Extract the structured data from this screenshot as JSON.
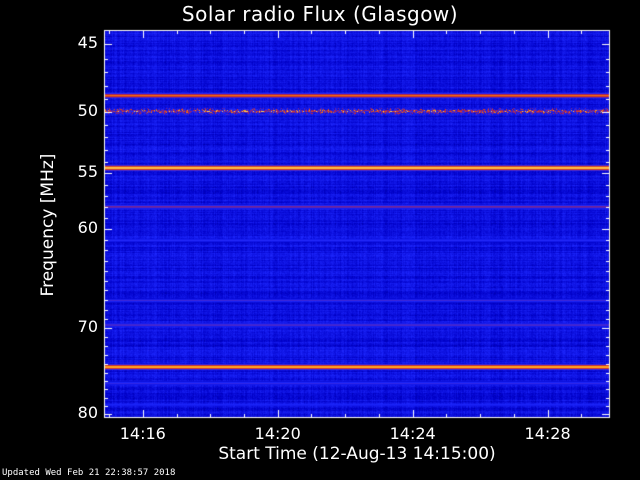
{
  "chart_data": {
    "type": "heatmap",
    "title": "Solar radio Flux (Glasgow)",
    "xlabel": "Start Time (12-Aug-13 14:15:00)",
    "ylabel": "Frequency [MHz]",
    "x_ticks": [
      "14:16",
      "14:20",
      "14:24",
      "14:28"
    ],
    "x_tick_minutes": [
      16,
      20,
      24,
      28
    ],
    "xlim_minutes": [
      14.85,
      29.85
    ],
    "y_ticks": [
      45,
      50,
      55,
      60,
      70,
      80
    ],
    "ylim_mhz": [
      44.0,
      80.5
    ],
    "y_scale": "log",
    "colormap": [
      "#000064",
      "#0000c8",
      "#1e28ff",
      "#c81e32",
      "#ff8c00",
      "#ffff96"
    ],
    "bright_bands_mhz": [
      {
        "freq": 48.7,
        "level": 0.78
      },
      {
        "freq": 49.9,
        "level": 0.7,
        "note": "intermittent spikes"
      },
      {
        "freq": 54.5,
        "level": 1.0
      },
      {
        "freq": 57.9,
        "level": 0.55
      },
      {
        "freq": 61.0,
        "level": 0.42
      },
      {
        "freq": 67.0,
        "level": 0.45
      },
      {
        "freq": 69.6,
        "level": 0.5
      },
      {
        "freq": 74.3,
        "level": 0.95
      },
      {
        "freq": 76.2,
        "level": 0.45
      },
      {
        "freq": 78.8,
        "level": 0.4
      }
    ]
  },
  "footer": {
    "updated": "Updated Wed Feb 21 22:38:57 2018"
  }
}
